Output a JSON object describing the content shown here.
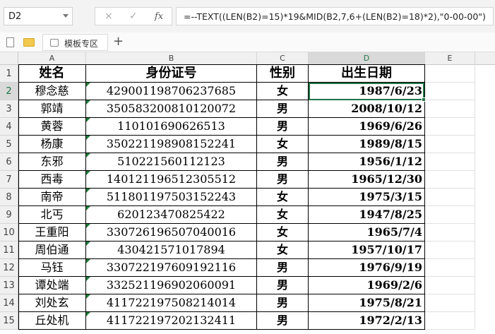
{
  "namebox": {
    "value": "D2"
  },
  "formula_bar": {
    "cancel_icon": "×",
    "accept_icon": "✓",
    "fx_label": "fx",
    "formula": "=--TEXT((LEN(B2)=15)*19&MID(B2,7,6+(LEN(B2)=18)*2),\"0-00-00\")"
  },
  "tabs": {
    "template_tab": "模板专区",
    "add": "+"
  },
  "columns": [
    "A",
    "B",
    "C",
    "D",
    "E"
  ],
  "rows": [
    "1",
    "2",
    "3",
    "4",
    "5",
    "6",
    "7",
    "8",
    "9",
    "10",
    "11",
    "12",
    "13",
    "14",
    "15"
  ],
  "headers": {
    "name": "姓名",
    "id": "身份证号",
    "gender": "性别",
    "birth": "出生日期"
  },
  "records": [
    {
      "name": "穆念慈",
      "id": "429001198706237685",
      "gender": "女",
      "birth": "1987/6/23"
    },
    {
      "name": "郭靖",
      "id": "350583200810120072",
      "gender": "男",
      "birth": "2008/10/12"
    },
    {
      "name": "黄蓉",
      "id": "110101690626513",
      "gender": "男",
      "birth": "1969/6/26"
    },
    {
      "name": "杨康",
      "id": "350221198908152241",
      "gender": "女",
      "birth": "1989/8/15"
    },
    {
      "name": "东邪",
      "id": "510221560112123",
      "gender": "男",
      "birth": "1956/1/12"
    },
    {
      "name": "西毒",
      "id": "140121196512305512",
      "gender": "男",
      "birth": "1965/12/30"
    },
    {
      "name": "南帝",
      "id": "511801197503152243",
      "gender": "女",
      "birth": "1975/3/15"
    },
    {
      "name": "北丐",
      "id": "620123470825422",
      "gender": "女",
      "birth": "1947/8/25"
    },
    {
      "name": "王重阳",
      "id": "330726196507040016",
      "gender": "女",
      "birth": "1965/7/4"
    },
    {
      "name": "周伯通",
      "id": "430421571017894",
      "gender": "女",
      "birth": "1957/10/17"
    },
    {
      "name": "马钰",
      "id": "330722197609192116",
      "gender": "男",
      "birth": "1976/9/19"
    },
    {
      "name": "谭处端",
      "id": "332521196902060091",
      "gender": "男",
      "birth": "1969/2/6"
    },
    {
      "name": "刘处玄",
      "id": "411722197508214014",
      "gender": "男",
      "birth": "1975/8/21"
    },
    {
      "name": "丘处机",
      "id": "411722197202132411",
      "gender": "男",
      "birth": "1972/2/13"
    }
  ],
  "colors": {
    "accent": "#217346",
    "error_triangle": "#1e7b3a"
  }
}
